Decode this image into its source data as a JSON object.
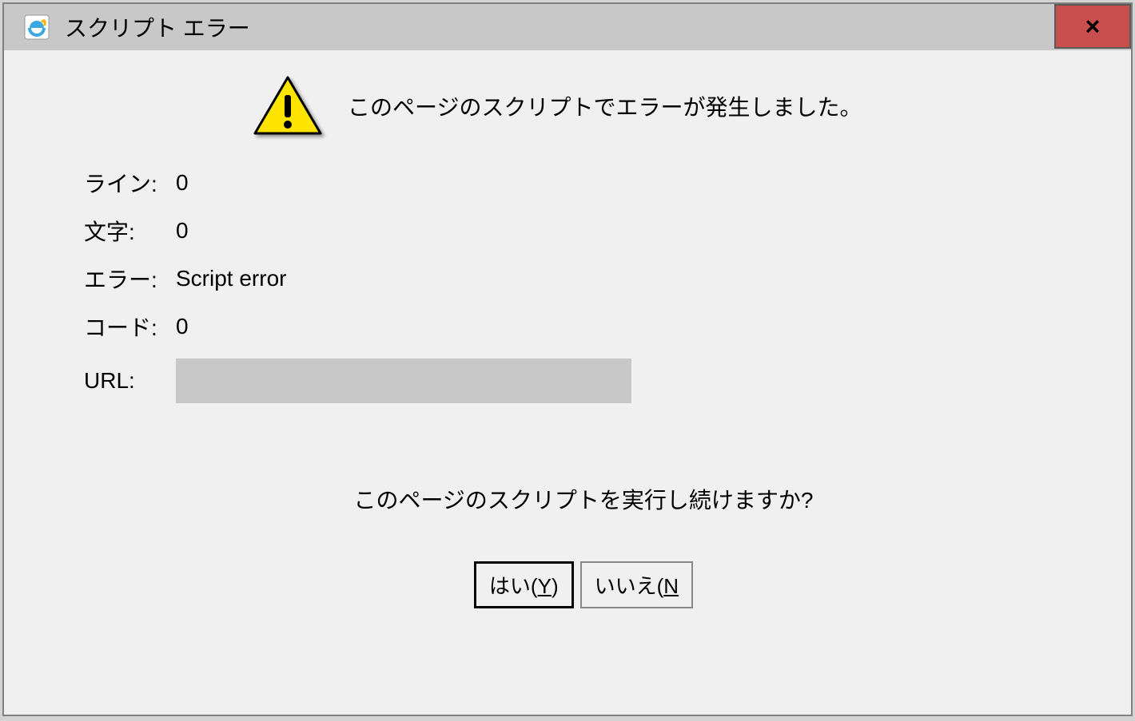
{
  "titlebar": {
    "title": "スクリプト エラー"
  },
  "close": {
    "label": "×"
  },
  "header": {
    "message": "このページのスクリプトでエラーが発生しました。"
  },
  "details": {
    "line_label": "ライン:",
    "line_value": "0",
    "char_label": "文字:",
    "char_value": "0",
    "error_label": "エラー:",
    "error_value": "Script error",
    "code_label": "コード:",
    "code_value": "0",
    "url_label": "URL:",
    "url_value": ""
  },
  "prompt": {
    "text": "このページのスクリプトを実行し続けますか?"
  },
  "buttons": {
    "yes_prefix": "はい(",
    "yes_accel": "Y",
    "yes_suffix": ")",
    "no_prefix": "いいえ(",
    "no_accel": "N",
    "no_suffix": ""
  }
}
